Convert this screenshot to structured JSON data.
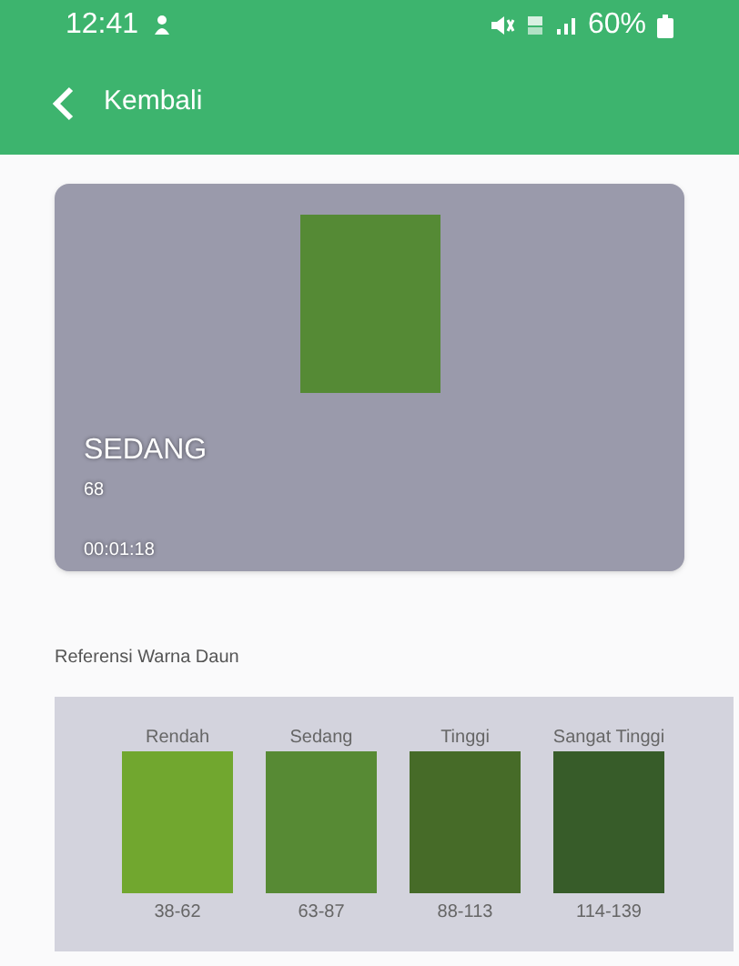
{
  "status_bar": {
    "time": "12:41",
    "battery": "60%"
  },
  "app_bar": {
    "back_label": "Kembali"
  },
  "result": {
    "color": "#558a35",
    "level_name": "SEDANG",
    "value": "68",
    "duration": "00:01:18"
  },
  "reference": {
    "title": "Referensi Warna Daun",
    "swatches": [
      {
        "label": "Rendah",
        "range": "38-62",
        "color": "#71a72f"
      },
      {
        "label": "Sedang",
        "range": "63-87",
        "color": "#578a34"
      },
      {
        "label": "Tinggi",
        "range": "88-113",
        "color": "#466b28"
      },
      {
        "label": "Sangat Tinggi",
        "range": "114-139",
        "color": "#375c29"
      }
    ]
  }
}
